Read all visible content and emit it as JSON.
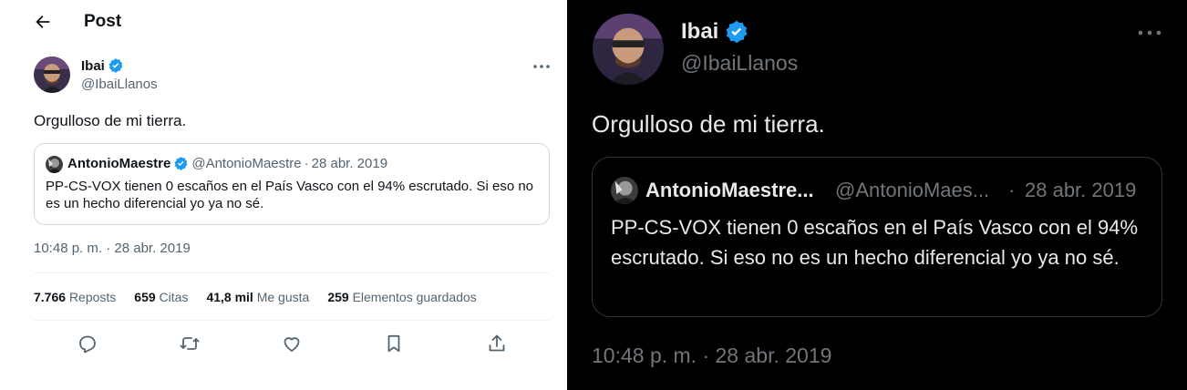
{
  "light": {
    "header": {
      "title": "Post",
      "back_icon": "arrow-left-icon"
    },
    "author": {
      "name": "Ibai",
      "handle": "@IbaiLlanos",
      "verified": true
    },
    "tweet_text": "Orgulloso de mi tierra.",
    "quote": {
      "name": "AntonioMaestre",
      "handle": "@AntonioMaestre",
      "separator": "·",
      "date": "28 abr. 2019",
      "text": "PP-CS-VOX tienen 0 escaños en el País Vasco con el 94% escrutado. Si eso no es un hecho diferencial yo ya no sé."
    },
    "timestamp": "10:48 p. m. · 28 abr. 2019",
    "stats": [
      {
        "value": "7.766",
        "label": "Reposts"
      },
      {
        "value": "659",
        "label": "Citas"
      },
      {
        "value": "41,8 mil",
        "label": "Me gusta"
      },
      {
        "value": "259",
        "label": "Elementos guardados"
      }
    ],
    "actions": [
      "reply-icon",
      "repost-icon",
      "like-icon",
      "bookmark-icon",
      "share-icon"
    ]
  },
  "dark": {
    "author": {
      "name": "Ibai",
      "handle": "@IbaiLlanos",
      "verified": true
    },
    "tweet_text": "Orgulloso de mi tierra.",
    "quote": {
      "name": "AntonioMaestre...",
      "handle": "@AntonioMaes...",
      "separator": "·",
      "date": "28 abr. 2019",
      "text": "PP-CS-VOX tienen 0 escaños en el País Vasco con el 94% escrutado. Si eso no es un hecho diferencial yo ya no sé."
    },
    "timestamp": "10:48 p. m. · 28 abr. 2019"
  },
  "colors": {
    "verified_blue": "#1d9bf0",
    "light_secondary_text": "#536471",
    "dark_secondary_text": "#71767b",
    "dark_background": "#000000"
  }
}
